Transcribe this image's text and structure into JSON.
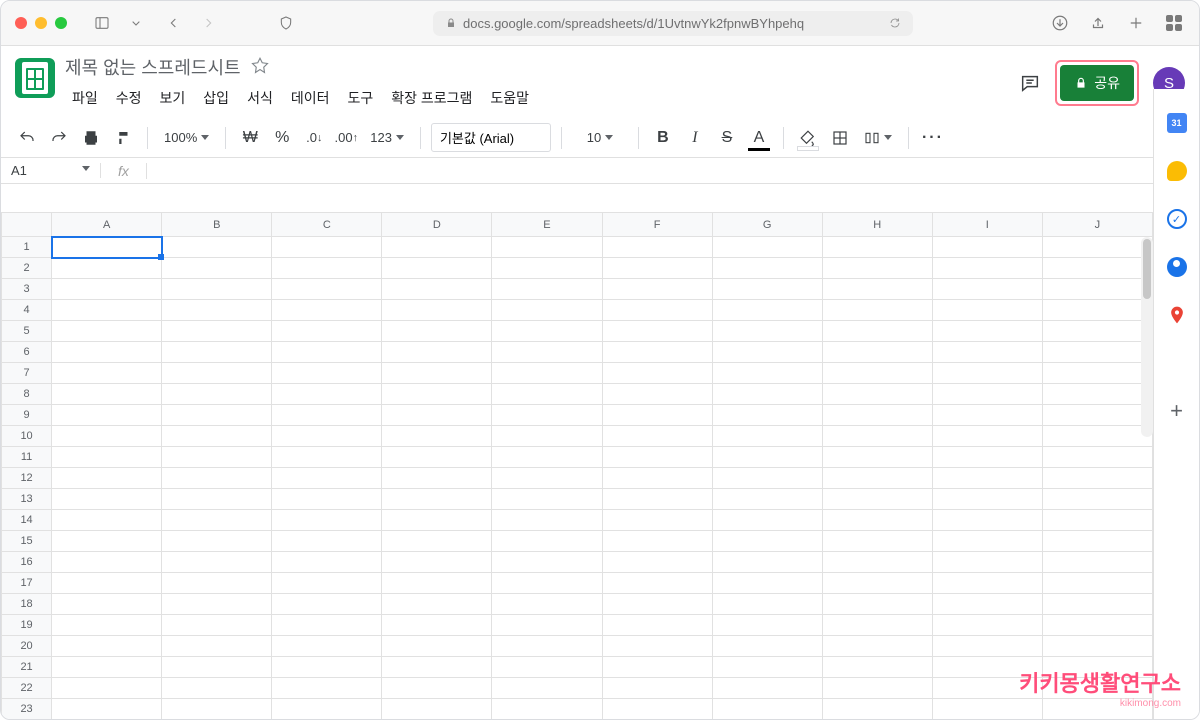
{
  "browser": {
    "url": "docs.google.com/spreadsheets/d/1UvtnwYk2fpnwBYhpehq"
  },
  "doc": {
    "title": "제목 없는 스프레드시트",
    "avatar": "S",
    "share_label": "공유"
  },
  "menus": [
    "파일",
    "수정",
    "보기",
    "삽입",
    "서식",
    "데이터",
    "도구",
    "확장 프로그램",
    "도움말"
  ],
  "toolbar": {
    "zoom": "100%",
    "currency": "₩",
    "percent": "%",
    "dec_dec": ".0",
    "dec_inc": ".00",
    "numfmt": "123",
    "font": "기본값 (Arial)",
    "size": "10",
    "bold": "B",
    "italic": "I",
    "strike": "S",
    "textcolor": "A",
    "more": "···"
  },
  "sheet": {
    "namebox": "A1",
    "fx": "fx",
    "cols": [
      "A",
      "B",
      "C",
      "D",
      "E",
      "F",
      "G",
      "H",
      "I",
      "J"
    ],
    "rows": 23,
    "selected": "A1"
  },
  "watermark": {
    "line1": "키키몽생활연구소",
    "line2": "kikimong.com"
  }
}
